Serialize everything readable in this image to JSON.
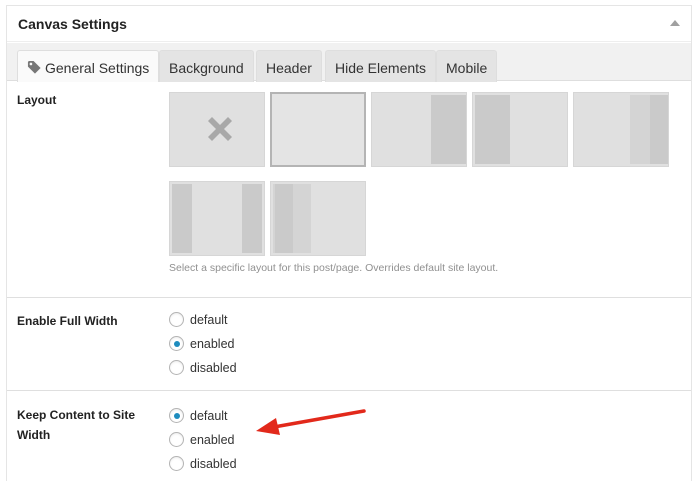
{
  "panel": {
    "title": "Canvas Settings"
  },
  "tabs": [
    {
      "label": "General Settings",
      "active": true
    },
    {
      "label": "Background",
      "active": false
    },
    {
      "label": "Header",
      "active": false
    },
    {
      "label": "Hide Elements",
      "active": false
    },
    {
      "label": "Mobile",
      "active": false
    }
  ],
  "layout": {
    "label": "Layout",
    "options": [
      "layout-default-icon",
      "layout-one-col-icon",
      "layout-two-col-left-icon",
      "layout-two-col-right-icon",
      "layout-three-col-left-icon",
      "layout-three-col-middle-icon",
      "layout-three-col-right-icon"
    ],
    "selected_index": 1,
    "description": "Select a specific layout for this post/page. Overrides default site layout."
  },
  "full_width": {
    "label": "Enable Full Width",
    "options": [
      "default",
      "enabled",
      "disabled"
    ],
    "selected": "enabled"
  },
  "site_width": {
    "label": "Keep Content to Site Width",
    "options": [
      "default",
      "enabled",
      "disabled"
    ],
    "selected": "default"
  },
  "colors": {
    "radio_checked": "#1e8cbe",
    "annotation_arrow": "#e2291b"
  }
}
